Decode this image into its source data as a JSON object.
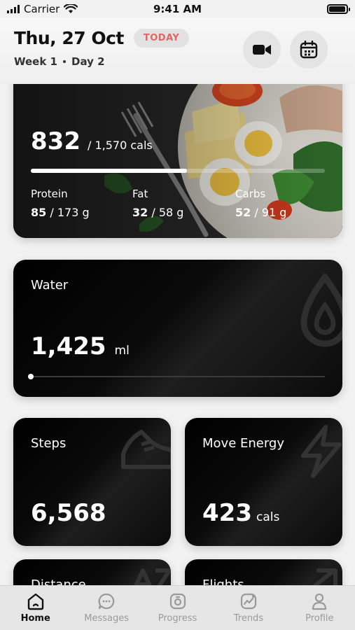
{
  "status": {
    "carrier": "Carrier",
    "time": "9:41 AM",
    "battery_level": 0.95
  },
  "header": {
    "date": "Thu, 27 Oct",
    "badge": "TODAY",
    "week": "Week 1",
    "day": "Day 2"
  },
  "calories": {
    "consumed": "832",
    "goal_text": "/ 1,570 cals",
    "progress": 0.53,
    "macros": [
      {
        "label": "Protein",
        "value": "85",
        "unit": "/ 173 g"
      },
      {
        "label": "Fat",
        "value": "32",
        "unit": "/ 58 g"
      },
      {
        "label": "Carbs",
        "value": "52",
        "unit": "/ 91 g"
      }
    ]
  },
  "water": {
    "title": "Water",
    "value": "1,425",
    "unit": "ml",
    "progress": 0.0
  },
  "steps": {
    "title": "Steps",
    "value": "6,568"
  },
  "move_energy": {
    "title": "Move Energy",
    "value": "423",
    "unit": "cals"
  },
  "distance": {
    "title": "Distance"
  },
  "flights": {
    "title": "Flights"
  },
  "tabs": [
    {
      "label": "Home",
      "icon": "home-icon"
    },
    {
      "label": "Messages",
      "icon": "chat-icon"
    },
    {
      "label": "Progress",
      "icon": "progress-icon"
    },
    {
      "label": "Trends",
      "icon": "trends-icon"
    },
    {
      "label": "Profile",
      "icon": "profile-icon"
    }
  ],
  "colors": {
    "accent_badge": "#e26464",
    "card_bg": "#000000"
  }
}
